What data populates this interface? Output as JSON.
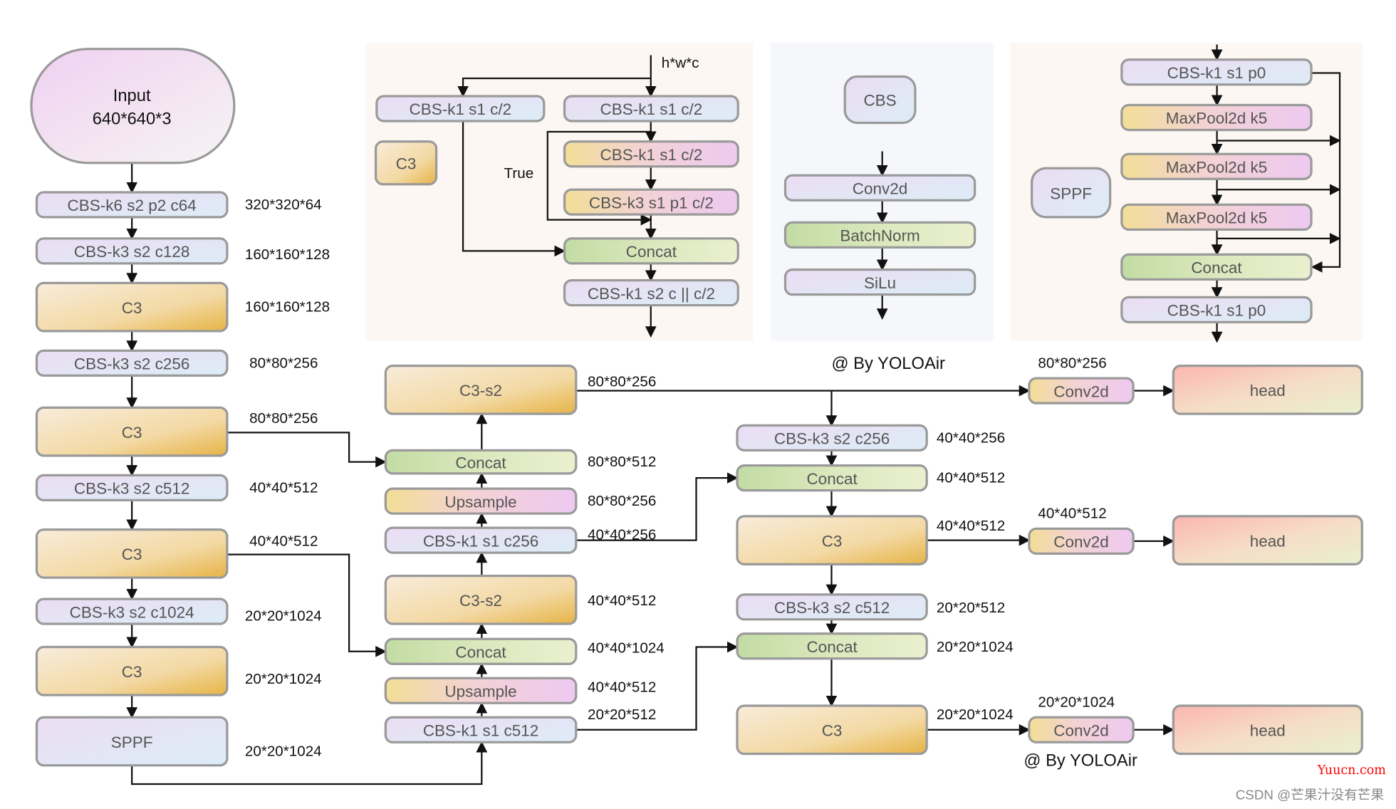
{
  "input": {
    "line1": "Input",
    "line2": "640*640*3"
  },
  "backbone": {
    "blocks": [
      "CBS-k6 s2 p2 c64",
      "CBS-k3 s2 c128",
      "C3",
      "CBS-k3 s2 c256",
      "C3",
      "CBS-k3 s2 c512",
      "C3",
      "CBS-k3 s2 c1024",
      "C3",
      "SPPF"
    ],
    "sizes": [
      "320*320*64",
      "160*160*128",
      "160*160*128",
      "80*80*256",
      "80*80*256",
      "40*40*512",
      "40*40*512",
      "20*20*1024",
      "20*20*1024",
      "20*20*1024"
    ]
  },
  "neck": {
    "blocks": [
      "C3-s2",
      "Concat",
      "Upsample",
      "CBS-k1 s1 c256",
      "C3-s2",
      "Concat",
      "Upsample",
      "CBS-k1 s1 c512"
    ],
    "sizes": [
      "80*80*256",
      "80*80*512",
      "80*80*256",
      "40*40*256",
      "40*40*512",
      "40*40*1024",
      "40*40*512",
      "20*20*512"
    ]
  },
  "pan": {
    "blocks": [
      "CBS-k3 s2 c256",
      "Concat",
      "C3",
      "CBS-k3 s2 c512",
      "Concat",
      "C3"
    ],
    "sizes": [
      "40*40*256",
      "40*40*512",
      "40*40*512",
      "20*20*512",
      "20*20*1024",
      "20*20*1024"
    ]
  },
  "heads": {
    "conv": [
      "Conv2d",
      "Conv2d",
      "Conv2d"
    ],
    "head": [
      "head",
      "head",
      "head"
    ],
    "sizes": [
      "80*80*256",
      "40*40*512",
      "20*20*1024"
    ]
  },
  "c3_panel": {
    "legend": "C3",
    "input_label": "h*w*c",
    "true_label": "True",
    "blocks": [
      "CBS-k1 s1 c/2",
      "CBS-k1 s1 c/2",
      "CBS-k1 s1 c/2",
      "CBS-k3 s1 p1 c/2",
      "Concat",
      "CBS-k1 s2 c || c/2"
    ]
  },
  "cbs_panel": {
    "legend": "CBS",
    "blocks": [
      "Conv2d",
      "BatchNorm",
      "SiLu"
    ]
  },
  "sppf_panel": {
    "legend": "SPPF",
    "blocks": [
      "CBS-k1 s1 p0",
      "MaxPool2d k5",
      "MaxPool2d k5",
      "MaxPool2d k5",
      "Concat",
      "CBS-k1 s1 p0"
    ]
  },
  "credits": {
    "top": "@ By YOLOAir",
    "bottom": "@ By YOLOAir"
  },
  "watermarks": {
    "site": "Yuucn.com",
    "author": "CSDN @芒果汁没有芒果"
  },
  "colors": {
    "site_watermark": "#ff0000",
    "panel_warm": "#fcf7f2",
    "panel_cool": "#f5f7fb",
    "border": "#9a9a9a"
  }
}
